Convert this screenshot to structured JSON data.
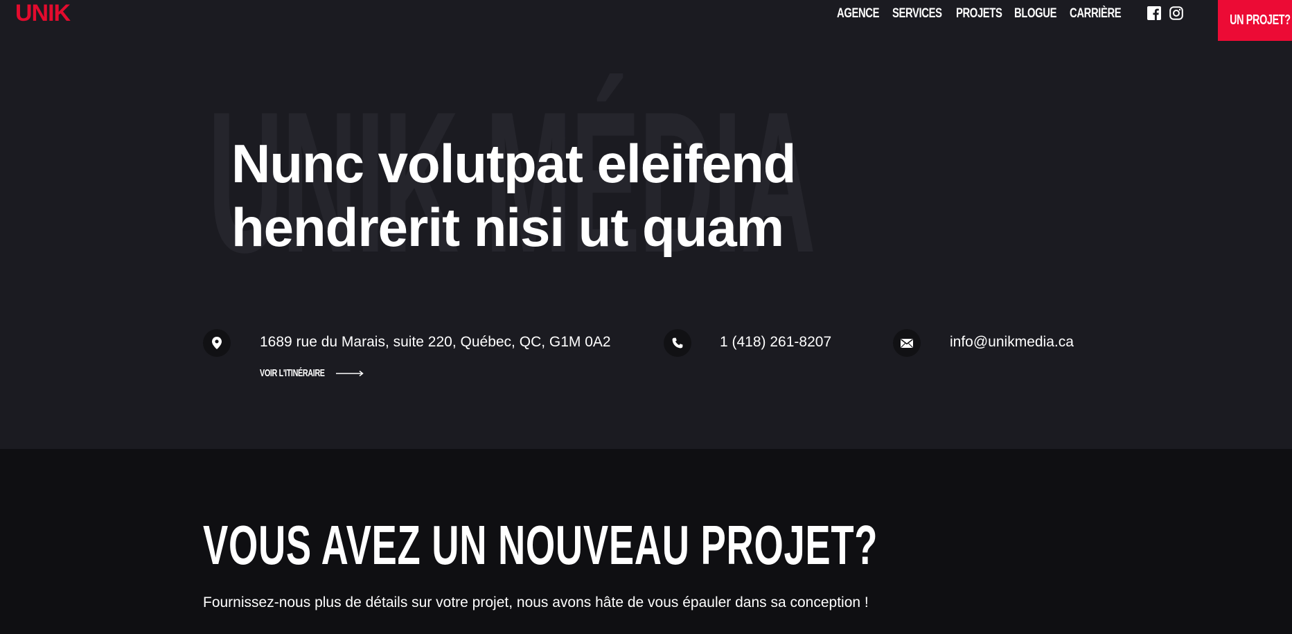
{
  "header": {
    "logo": "UNIK",
    "nav": [
      "AGENCE",
      "SERVICES",
      "PROJETS",
      "BLOGUE",
      "CARRIÈRE"
    ],
    "social": [
      "facebook-icon",
      "instagram-icon"
    ],
    "cta": "UN PROJET?"
  },
  "hero": {
    "watermark": "UNIK MÉDIA",
    "title_line1": "Nunc volutpat eleifend",
    "title_line2": "hendrerit nisi ut quam"
  },
  "contact": {
    "address": "1689 rue du Marais, suite 220, Québec, QC, G1M 0A2",
    "itinerary": "VOIR L'ITINÉRAIRE",
    "phone": "1 (418) 261-8207",
    "email": "info@unikmedia.ca"
  },
  "project": {
    "title": "VOUS AVEZ UN NOUVEAU PROJET?",
    "subtitle": "Fournissez-nous plus de détails sur votre projet, nous avons hâte de vous épauler dans sa conception !"
  },
  "colors": {
    "accent": "#ec0b35",
    "background": "#1b1b21",
    "lower_background": "#0f0f12"
  }
}
